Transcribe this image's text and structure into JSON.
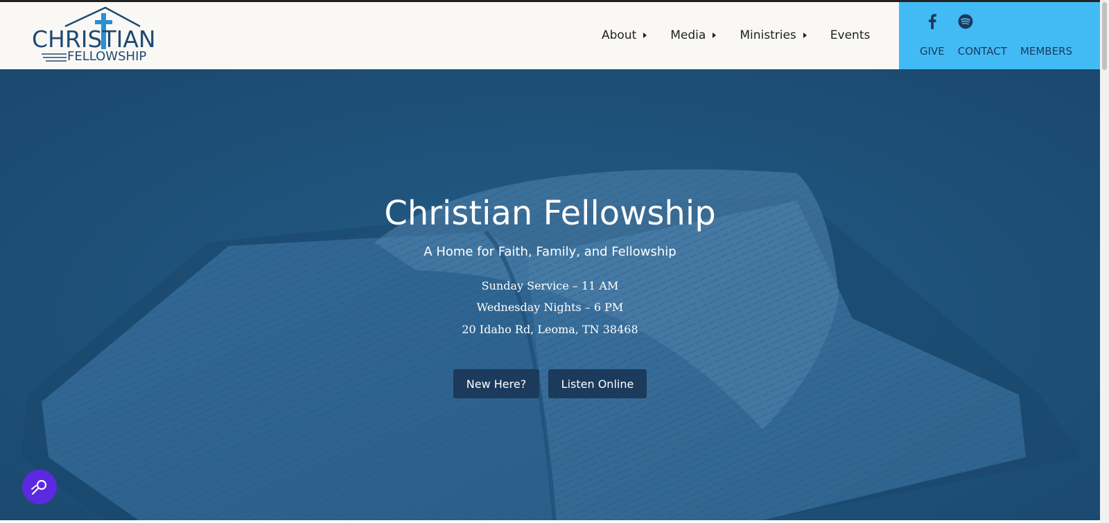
{
  "logo": {
    "line1": "CHRISTIAN",
    "line2": "FELLOWSHIP"
  },
  "nav": {
    "items": [
      {
        "label": "About",
        "has_dropdown": true
      },
      {
        "label": "Media",
        "has_dropdown": true
      },
      {
        "label": "Ministries",
        "has_dropdown": true
      },
      {
        "label": "Events",
        "has_dropdown": false
      }
    ]
  },
  "side_panel": {
    "social": [
      "facebook-icon",
      "spotify-icon"
    ],
    "links": [
      "GIVE",
      "CONTACT",
      "MEMBERS"
    ]
  },
  "hero": {
    "title": "Christian Fellowship",
    "subtitle": "A Home for Faith, Family, and Fellowship",
    "service_sunday": "Sunday Service – 11 AM",
    "service_wednesday": "Wednesday Nights – 6 PM",
    "address": "20 Idaho Rd, Leoma, TN 38468",
    "buttons": {
      "new_here": "New Here?",
      "listen_online": "Listen Online"
    }
  },
  "colors": {
    "header_bg": "#f9f8f5",
    "side_panel_bg": "#42bbf5",
    "brand_navy": "#1e4a73",
    "hero_overlay": "#23587f",
    "button_bg": "#1b3a5c",
    "accessibility_button": "#5b2ae0"
  },
  "accessibility": {
    "icon": "accessibility-search-icon"
  }
}
